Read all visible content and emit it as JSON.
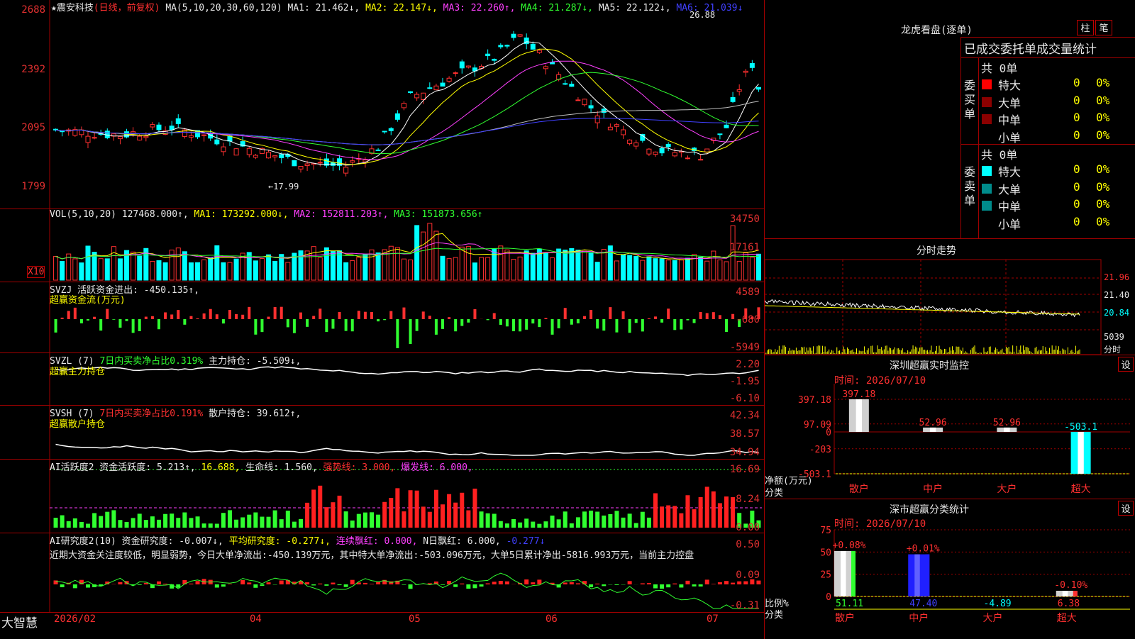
{
  "header": {
    "stock": "★震安科技",
    "mode": "(日线，前复权)",
    "ma_label": "MA(5,10,20,30,60,120)",
    "ma1": "MA1: 21.462↓,",
    "ma2": "MA2: 22.147↓,",
    "ma3": "MA3: 22.260↑,",
    "ma4": "MA4: 21.287↓,",
    "ma5": "MA5: 22.122↓,",
    "ma6": "MA6: 21.039↓",
    "high_mark": "26.88",
    "low_mark": "←17.99"
  },
  "price_axis": [
    "2688",
    "2392",
    "2095",
    "1799"
  ],
  "vol": {
    "label": "VOL(5,10,20)",
    "value": "127468.000↑,",
    "ma1": "MA1: 173292.000↓,",
    "ma2": "MA2: 152811.203↑,",
    "ma3": "MA3: 151873.656↑",
    "axis": [
      "34750",
      "17161"
    ],
    "unit": "X10"
  },
  "svzj": {
    "line1": "SVZJ  活跃资金进出: -450.135↑,",
    "line2": "超赢资金流(万元)",
    "axis": [
      "4589",
      "-680",
      "-5949"
    ]
  },
  "svzl": {
    "label": "SVZL (7)",
    "sub": "7日内买卖净占比0.319%",
    "val": "主力持仓: -5.509↓,",
    "line2": "超赢主力持仓",
    "axis": [
      "2.20",
      "-1.95",
      "-6.10"
    ]
  },
  "svsh": {
    "label": "SVSH (7)",
    "sub": "7日内买卖净占比0.191%",
    "val": "散户持仓: 39.612↑,",
    "line2": "超赢散户持仓",
    "axis": [
      "42.34",
      "38.57",
      "34.94"
    ]
  },
  "ai1": {
    "a": "AI活跃度2 资金活跃度: 5.213↑,",
    "b": "16.688,",
    "c": "生命线: 1.560,",
    "d": "强势线: 3.000,",
    "e": "爆发线: 6.000,",
    "axis": [
      "16.69",
      "8.24",
      "0.00"
    ]
  },
  "ai2": {
    "a": "AI研究度2(10) 资金研究度: -0.007↓,",
    "b": "平均研究度: -0.277↓,",
    "c": "连续飘红: 0.000,",
    "d": "N日飘红: 6.000,",
    "e": "-0.277↓",
    "note": "近期大资金关注度较低，明显弱势，今日大单净流出:-450.139万元，其中特大单净流出:-503.096万元，大单5日累计净出-5816.993万元，当前主力控盘",
    "axis": [
      "0.50",
      "0.09",
      "-0.31"
    ]
  },
  "xaxis": {
    "brand": "大智慧",
    "ticks": [
      "2026/02",
      "04",
      "05",
      "06",
      "07"
    ]
  },
  "lhb": {
    "title": "龙虎看盘(逐单)",
    "btn1": "柱",
    "btn2": "笔",
    "sub": "已成交委托单成交量统计",
    "buy_side": "委买单",
    "sell_side": "委卖单",
    "buy_total": "共 0单",
    "sell_total": "共 0单",
    "rows": [
      {
        "name": "特大",
        "count": "0",
        "pct": "0%"
      },
      {
        "name": "大单",
        "count": "0",
        "pct": "0%"
      },
      {
        "name": "中单",
        "count": "0",
        "pct": "0%"
      },
      {
        "name": "小单",
        "count": "0",
        "pct": "0%"
      }
    ],
    "buy_colors": [
      "#ff0000",
      "#8b0000",
      "#8b0000",
      "#000000"
    ],
    "sell_colors": [
      "#00ffff",
      "#008b8b",
      "#008b8b",
      "#000000"
    ]
  },
  "intraday": {
    "title": "分时走势",
    "axis": [
      "21.96",
      "21.40",
      "20.84"
    ],
    "vol_top": "5039",
    "vol_unit": "分时"
  },
  "monitor": {
    "title": "深圳超赢实时监控",
    "btn": "设",
    "time": "时间: 2026/07/10",
    "ylabel": "净额(万元)",
    "xlabel": "分类",
    "axis": [
      "397.18",
      "97.09",
      "0",
      "-203",
      "-503.1"
    ]
  },
  "classify": {
    "title": "深市超赢分类统计",
    "btn": "设",
    "time": "时间: 2026/07/10",
    "ylabel": "比例%",
    "xlabel": "分类",
    "axis": [
      "75",
      "50",
      "25",
      "0"
    ]
  },
  "chart_data": [
    {
      "type": "bar",
      "title": "深圳超赢实时监控",
      "ylabel": "净额(万元)",
      "xlabel": "分类",
      "categories": [
        "散户",
        "中户",
        "大户",
        "超大"
      ],
      "values": [
        397.18,
        52.96,
        52.96,
        -503.1
      ],
      "labels": [
        "397.18",
        "52.96",
        "52.96",
        "-503.1"
      ],
      "ylim": [
        -503.1,
        397.18
      ]
    },
    {
      "type": "bar",
      "title": "深市超赢分类统计",
      "ylabel": "比例%",
      "xlabel": "分类",
      "categories": [
        "散户",
        "中户",
        "大户",
        "超大"
      ],
      "values": [
        51.11,
        47.4,
        -4.89,
        6.38
      ],
      "bar_labels": [
        "+0.08%",
        "+0.01%",
        "",
        "-0.10%"
      ],
      "value_labels": [
        "51.11",
        "47.40",
        "-4.89",
        "6.38"
      ],
      "ylim": [
        0,
        75
      ]
    }
  ]
}
